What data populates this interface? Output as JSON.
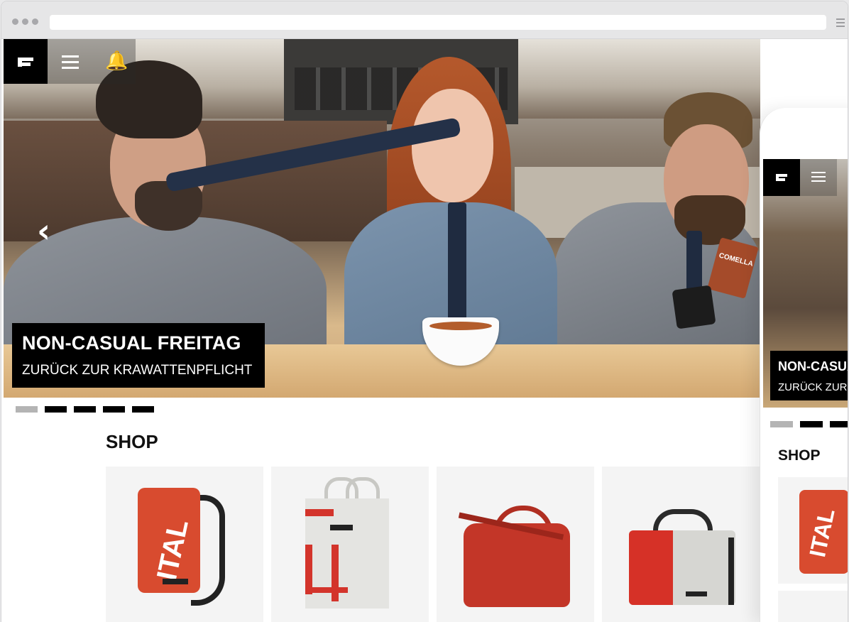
{
  "browser": {
    "url": "",
    "menu_icon": "hamburger-icon"
  },
  "site_nav": {
    "logo_icon": "freitag-logo-icon",
    "menu_icon": "hamburger-icon",
    "notification_icon": "bell-icon"
  },
  "hero": {
    "title": "NON-CASUAL FREITAG",
    "subtitle": "ZURÜCK ZUR KRAWATTENPFLICHT",
    "prev_icon": "chevron-left-icon",
    "product_label": "COMELLA",
    "slides_total": 5,
    "active_slide": 1
  },
  "shop": {
    "title": "SHOP",
    "products": [
      {
        "name": "red-backpack",
        "print": "ITAL"
      },
      {
        "name": "white-tote-bag"
      },
      {
        "name": "red-duffel-bag"
      },
      {
        "name": "red-grey-messenger-bag"
      }
    ]
  },
  "mobile": {
    "hero_title": "NON-CASUA",
    "hero_subtitle": "ZURÜCK ZUR",
    "shop_title": "SHOP",
    "product_print": "ITAL"
  }
}
